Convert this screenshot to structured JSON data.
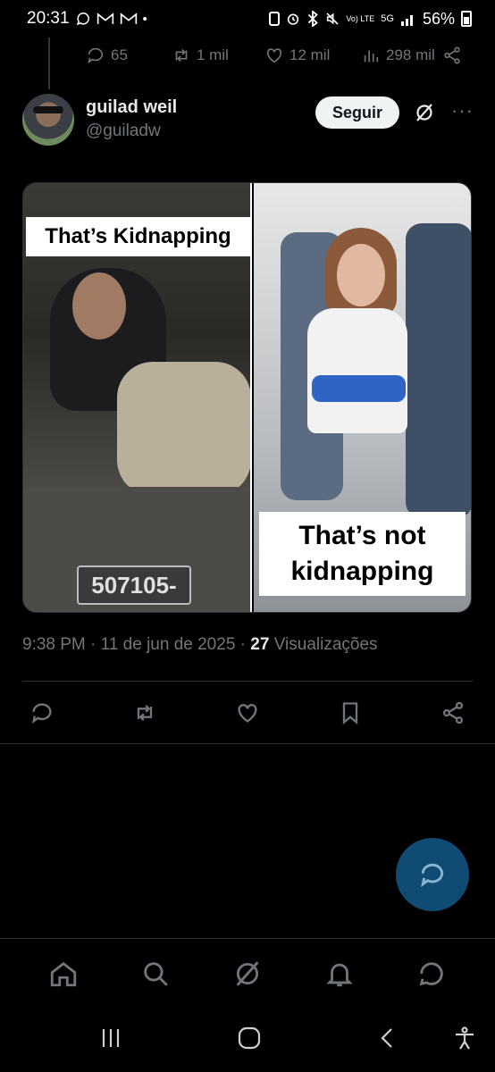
{
  "status_bar": {
    "time": "20:31",
    "battery": "56%",
    "signal_label": "Vo) LTE",
    "network": "5G"
  },
  "prev_tweet": {
    "replies": "65",
    "reposts": "1 mil",
    "likes": "12 mil",
    "views": "298 mil"
  },
  "author": {
    "name": "guilad weil",
    "handle": "@guiladw",
    "follow_label": "Seguir"
  },
  "media": {
    "left_caption": "That’s Kidnapping",
    "right_caption_line1": "That’s not",
    "right_caption_line2": "kidnapping",
    "plate_number": "507105-"
  },
  "meta": {
    "time": "9:38 PM",
    "dot1": "·",
    "date": "11 de jun de 2025",
    "dot2": "·",
    "views_count": "27",
    "views_label": "Visualizações"
  },
  "icons": {
    "reply": "reply-icon",
    "repost": "repost-icon",
    "like": "like-icon",
    "bookmark": "bookmark-icon",
    "share": "share-icon",
    "home": "home-icon",
    "search": "search-icon",
    "grok": "grok-icon",
    "notifications": "bell-icon",
    "messages": "messages-icon"
  },
  "colors": {
    "background": "#000000",
    "text_primary": "#e7e9ea",
    "text_secondary": "#71767b",
    "divider": "#2f3336",
    "fab": "#0f4b73"
  }
}
